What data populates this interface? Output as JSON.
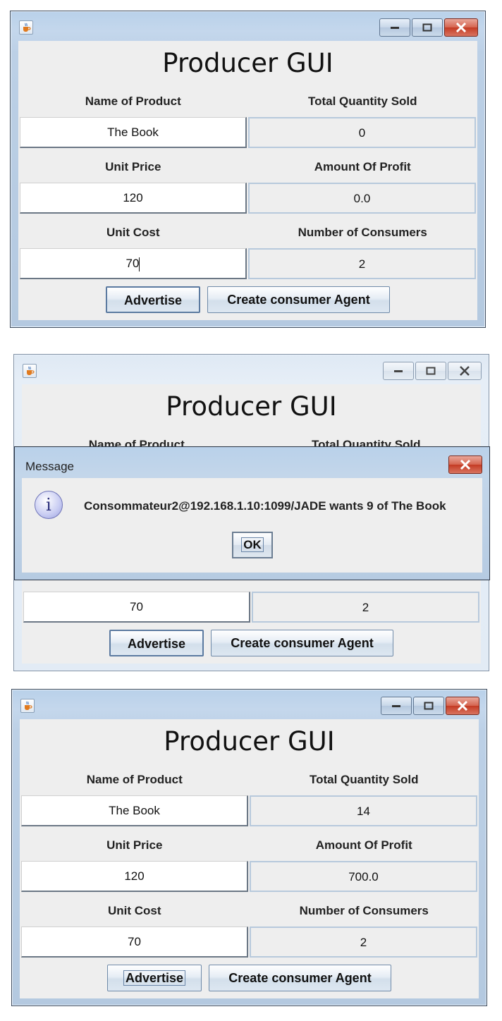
{
  "window_top": {
    "app_title": "Producer GUI",
    "labels": {
      "name": "Name of Product",
      "total_sold": "Total Quantity Sold",
      "unit_price": "Unit Price",
      "profit": "Amount Of Profit",
      "unit_cost": "Unit Cost",
      "consumers": "Number of Consumers"
    },
    "values": {
      "name": "The Book",
      "total_sold": "0",
      "unit_price": "120",
      "profit": "0.0",
      "unit_cost": "70",
      "consumers": "2"
    },
    "buttons": {
      "advertise": "Advertise",
      "create": "Create consumer Agent"
    }
  },
  "window_middle": {
    "app_title": "Producer GUI",
    "labels": {
      "name": "Name of Product",
      "total_sold": "Total Quantity Sold"
    },
    "values": {
      "unit_cost": "70",
      "consumers": "2"
    },
    "buttons": {
      "advertise": "Advertise",
      "create": "Create consumer Agent"
    },
    "dialog": {
      "title": "Message",
      "message": "Consommateur2@192.168.1.10:1099/JADE wants 9 of The Book",
      "ok": "OK"
    }
  },
  "window_bottom": {
    "app_title": "Producer GUI",
    "labels": {
      "name": "Name of Product",
      "total_sold": "Total Quantity Sold",
      "unit_price": "Unit Price",
      "profit": "Amount Of Profit",
      "unit_cost": "Unit Cost",
      "consumers": "Number of Consumers"
    },
    "values": {
      "name": "The Book",
      "total_sold": "14",
      "unit_price": "120",
      "profit": "700.0",
      "unit_cost": "70",
      "consumers": "2"
    },
    "buttons": {
      "advertise": "Advertise",
      "create": "Create consumer Agent"
    }
  },
  "icons": {
    "app": "java-cup-icon",
    "minimize": "minimize-icon",
    "maximize": "maximize-icon",
    "close": "close-icon",
    "info": "information-icon"
  },
  "colors": {
    "close_active": "#c43b24",
    "window_frame": "#b9d1ea",
    "panel": "#eeeeee"
  }
}
